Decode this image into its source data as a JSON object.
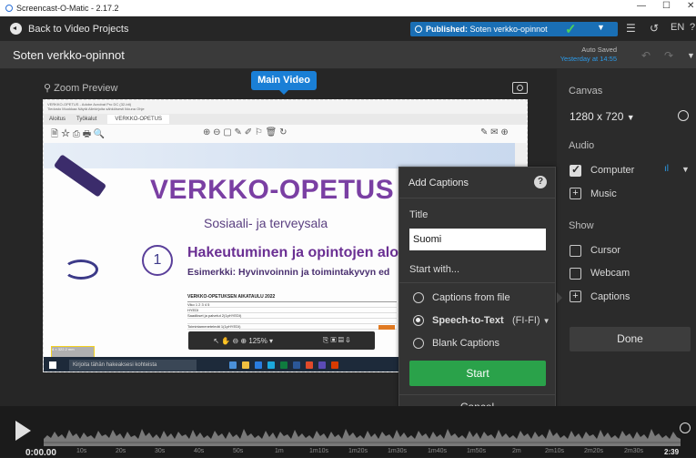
{
  "window": {
    "title": "Screencast-O-Matic - 2.17.2",
    "min": "—",
    "max": "☐",
    "close": "✕"
  },
  "topbar": {
    "back_label": "Back to Video Projects",
    "published_prefix": "Published:",
    "published_name": "Soten verkko-opinnot",
    "language": "EN",
    "help": "?"
  },
  "project": {
    "title": "Soten verkko-opinnot",
    "autosave_line1": "Auto Saved",
    "autosave_line2": "Yesterday at 14:55"
  },
  "editor": {
    "zoom_label": "Zoom Preview",
    "main_video_tag": "Main Video"
  },
  "preview": {
    "window_title": "VERKKO-OPETUS - Adobe Acrobat Pro DC (32-bit)",
    "menu": "Tiedosto  Muokkaa  Näytä  Allekirjoita sähköisesti  Ikkuna  Ohje",
    "tabs": [
      "Aloitus",
      "Työkalut",
      "VERKKO-OPETUS"
    ],
    "slide": {
      "big_title": "VERKKO-OPETUS",
      "subtitle": "Sosiaali- ja terveysala",
      "number": "1",
      "heading": "Hakeutuminen ja opintojen alo",
      "subheading": "Esimerkki: Hyvinvoinnin ja toimintakyvyn ed",
      "table_title": "VERKKO-OPETUKSEN AIKATAULU 2022",
      "table_rows": [
        "Viko                                     1  2  3  4  5",
        "HYEDI",
        "Saadikset ja palvelut 2(1pHYEDI)",
        "",
        "Toimintamenetelmät 1(1pHYEDI)"
      ]
    },
    "float_toolbar": "↖  ✋  ⊖  ⊕  125%  ▾",
    "taskbar_search": "Kirjoita tähän hakeaksesi kohteista",
    "yellow_box_text": "4 × 322.2 mm"
  },
  "right_panel": {
    "canvas_label": "Canvas",
    "canvas_value": "1280 x 720",
    "audio_label": "Audio",
    "computer_label": "Computer",
    "music_label": "Music",
    "show_label": "Show",
    "cursor_label": "Cursor",
    "webcam_label": "Webcam",
    "captions_label": "Captions",
    "done_label": "Done"
  },
  "captions_dialog": {
    "title": "Add Captions",
    "title_label": "Title",
    "title_value": "Suomi",
    "start_with_label": "Start with...",
    "options": [
      {
        "label": "Captions from file",
        "selected": false
      },
      {
        "label": "Speech-to-Text",
        "suffix": "(FI-FI)",
        "selected": true
      },
      {
        "label": "Blank Captions",
        "selected": false
      }
    ],
    "start_label": "Start",
    "cancel_label": "Cancel"
  },
  "timeline": {
    "current_time": "0:00.00",
    "ticks": [
      "10s",
      "20s",
      "30s",
      "40s",
      "50s",
      "1m",
      "1m10s",
      "1m20s",
      "1m30s",
      "1m40s",
      "1m50s",
      "2m",
      "2m10s",
      "2m20s",
      "2m30s"
    ],
    "end_time": "2:39"
  },
  "colors": {
    "accent": "#1a7fd6",
    "start_green": "#2aa24a",
    "published_blue": "#1a6fb5",
    "autosave_blue": "#2b9ae8"
  }
}
